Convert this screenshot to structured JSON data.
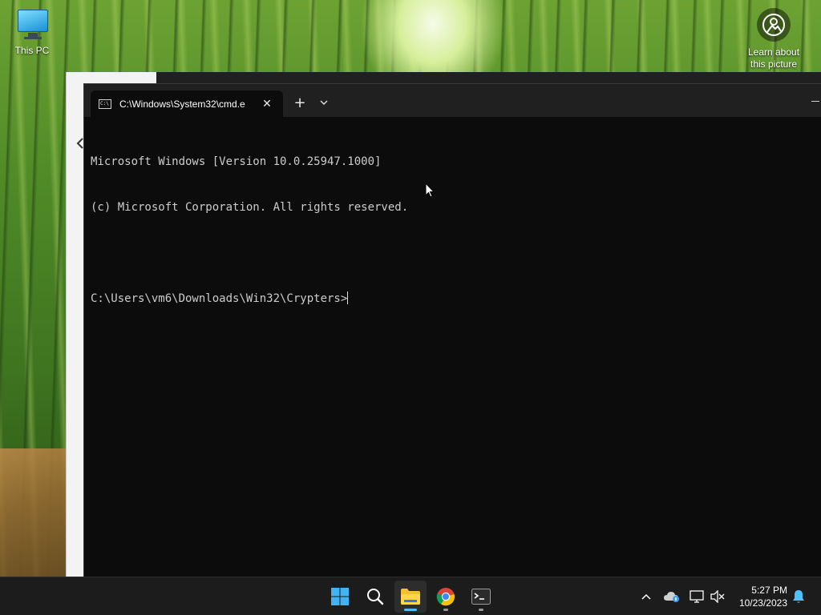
{
  "desktop": {
    "this_pc_label": "This PC",
    "learn_label_line1": "Learn about",
    "learn_label_line2": "this picture"
  },
  "terminal": {
    "tab_title": "C:\\Windows\\System32\\cmd.e",
    "tab_close_glyph": "✕",
    "new_tab_glyph": "+",
    "tab_icon_text": "C:\\",
    "lines": [
      "Microsoft Windows [Version 10.0.25947.1000]",
      "(c) Microsoft Corporation. All rights reserved.",
      "",
      "C:\\Users\\vm6\\Downloads\\Win32\\Crypters>"
    ]
  },
  "taskbar": {
    "time": "5:27 PM",
    "date": "10/23/2023",
    "apps": [
      "start-icon",
      "search-icon",
      "file-explorer-icon",
      "chrome-icon",
      "terminal-icon"
    ]
  },
  "colors": {
    "terminal_bg": "#0c0c0c",
    "terminal_text": "#cccccc",
    "taskbar_bg": "#1c1c1c",
    "accent": "#4cc2ff"
  }
}
